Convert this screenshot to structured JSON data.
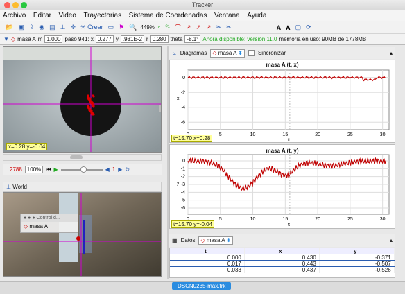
{
  "window": {
    "title": "Tracker"
  },
  "menu": [
    "Archivo",
    "Editar",
    "Video",
    "Trayectorias",
    "Sistema de Coordenadas",
    "Ventana",
    "Ayuda"
  ],
  "toolbar": {
    "crear": "Crear",
    "zoom": "449%",
    "font_big": "A",
    "font_small": "A"
  },
  "tracktoolbar": {
    "track": "masa A",
    "m_label": "m",
    "m": "1.000",
    "paso_label": "paso 941: x",
    "x": "0.277",
    "y_label": "y",
    "y": ".931E-2",
    "r_label": "r",
    "r": "0.280",
    "theta_label": "theta",
    "theta": "-8.1°",
    "update": "Ahora disponible: versión 11.0",
    "memory": "memoria en uso: 90MB de 1778MB"
  },
  "video": {
    "readout": "x=0.28  y=-0.04",
    "frame": "2788",
    "zoom": "100%",
    "step": "1"
  },
  "world": {
    "title": "World",
    "control_title": "Control d...",
    "track": "masa A"
  },
  "plots": {
    "header_label": "Diagramas",
    "track": "masa A",
    "sync": "Sincronizar",
    "p1": {
      "title": "masa A (t, x)",
      "ylabel": "x",
      "xlabel": "t",
      "readout": "t=15.70  x=0.28",
      "yticks": [
        "0",
        "-2",
        "-4",
        "-6"
      ],
      "xticks": [
        "0",
        "5",
        "10",
        "15",
        "20",
        "25",
        "30"
      ]
    },
    "p2": {
      "title": "masa A (t, y)",
      "ylabel": "y",
      "xlabel": "t",
      "readout": "t=15.70  y=-0.04",
      "yticks": [
        "0",
        "-1",
        "-2",
        "-3",
        "-4",
        "-5",
        "-6"
      ],
      "xticks": [
        "0",
        "5",
        "10",
        "15",
        "20",
        "25",
        "30"
      ]
    }
  },
  "table": {
    "label": "Datos",
    "track": "masa A",
    "cols": [
      "t",
      "x",
      "y"
    ],
    "rows": [
      [
        "0.000",
        "0.430",
        "-0.371"
      ],
      [
        "0.017",
        "0.443",
        "-0.507"
      ],
      [
        "0.033",
        "0.437",
        "-0.526"
      ]
    ]
  },
  "footer": {
    "tab": "DSCN0235-max.trk"
  },
  "colors": {
    "track": "#cc0000",
    "crosshair": "#d000d0",
    "accent": "#2a8ce0"
  }
}
